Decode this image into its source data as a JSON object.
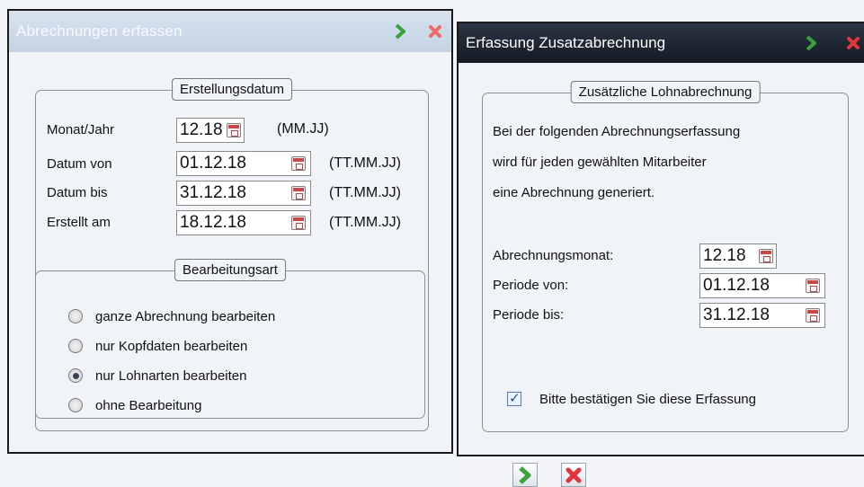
{
  "left_dialog": {
    "title": "Abrechnungen erfassen",
    "date_group": {
      "title": "Erstellungsdatum",
      "rows": [
        {
          "label": "Monat/Jahr",
          "value": "12.18",
          "format": "(MM.JJ)"
        },
        {
          "label": "Datum von",
          "value": "01.12.18",
          "format": "(TT.MM.JJ)"
        },
        {
          "label": "Datum bis",
          "value": "31.12.18",
          "format": "(TT.MM.JJ)"
        },
        {
          "label": "Erstellt am",
          "value": "18.12.18",
          "format": "(TT.MM.JJ)"
        }
      ]
    },
    "mode_group": {
      "title": "Bearbeitungsart",
      "options": [
        {
          "label": "ganze Abrechnung bearbeiten",
          "selected": false
        },
        {
          "label": "nur Kopfdaten bearbeiten",
          "selected": false
        },
        {
          "label": "nur Lohnarten bearbeiten",
          "selected": true
        },
        {
          "label": "ohne Bearbeitung",
          "selected": false
        }
      ]
    }
  },
  "right_dialog": {
    "title": "Erfassung Zusatzabrechnung",
    "group": {
      "title": "Zusätzliche Lohnabrechnung",
      "description": [
        "Bei der folgenden Abrechnungserfassung",
        "wird für jeden gewählten Mitarbeiter",
        "eine Abrechnung generiert."
      ],
      "fields": [
        {
          "label": "Abrechnungsmonat:",
          "value": "12.18"
        },
        {
          "label": "Periode von:",
          "value": "01.12.18"
        },
        {
          "label": "Periode bis:",
          "value": "31.12.18"
        }
      ],
      "confirm": {
        "label": "Bitte bestätigen Sie diese Erfassung",
        "checked": true
      }
    }
  },
  "colors": {
    "ok_green": "#3aa23a",
    "cancel_red": "#e2343a",
    "dark_titlebar": "#1b2230"
  },
  "icons": [
    "ok-check-icon",
    "close-x-icon",
    "calendar-icon"
  ]
}
